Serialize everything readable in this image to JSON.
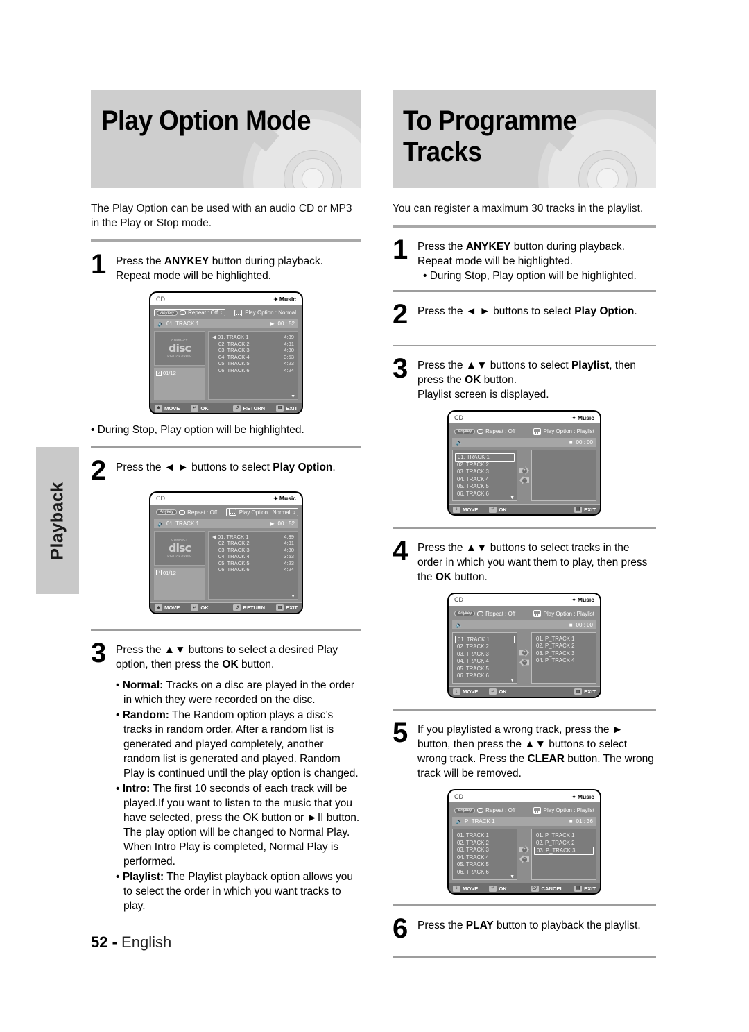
{
  "side_tab": {
    "label": "Playback"
  },
  "left": {
    "banner_title": "Play Option Mode",
    "intro": "The Play Option can be used with an audio CD or MP3 in the Play or Stop mode.",
    "steps": [
      {
        "num": "1",
        "line1_a": "Press the ",
        "line1_b": "ANYKEY",
        "line1_c": " button during playback.",
        "line2": "Repeat mode will be highlighted."
      },
      {
        "num": "2",
        "line1_a": "Press the ",
        "line1_b": "◄ ►",
        "line1_c": " buttons to select ",
        "line1_d": "Play Option",
        "line1_e": "."
      },
      {
        "num": "3",
        "line1_a": "Press the ",
        "line1_b": "▲▼",
        "line1_c": " buttons to select a desired Play option, then press the ",
        "line1_d": "OK",
        "line1_e": " button."
      }
    ],
    "note_stop": "• During Stop, Play option will be highlighted.",
    "bullets": [
      {
        "term": "Normal:",
        "text": " Tracks on a disc are played in the order in which they were recorded on the disc."
      },
      {
        "term": "Random:",
        "text": " The Random option plays a disc’s tracks in random order. After a random list is generated and played completely, another random list is generated and played. Random Play is continued until the play option is changed."
      },
      {
        "term": "Intro:",
        "text": " The first 10 seconds of each track will be played.If you want to listen to the music that you have selected, press the OK button or ►II button. The play option will be changed to Normal Play. When Intro Play is completed, Normal Play is performed."
      },
      {
        "term": "Playlist:",
        "text": " The Playlist playback option allows you to select the order in which you want tracks to play."
      }
    ]
  },
  "right": {
    "banner_title": "To Programme Tracks",
    "intro": "You can register a maximum 30 tracks in the playlist.",
    "steps": [
      {
        "num": "1",
        "line1_a": "Press the ",
        "line1_b": "ANYKEY",
        "line1_c": " button during playback.",
        "line2": "Repeat mode will be highlighted.",
        "note": "• During Stop, Play option will be highlighted."
      },
      {
        "num": "2",
        "line1_a": "Press the ",
        "line1_b": "◄ ►",
        "line1_c": " buttons to select ",
        "line1_d": "Play Option",
        "line1_e": "."
      },
      {
        "num": "3",
        "line1_a": "Press the ",
        "line1_b": "▲▼",
        "line1_c": " buttons to select ",
        "line1_d": "Playlist",
        "line1_e": ", then press the ",
        "line1_f": "OK",
        "line1_g": " button.",
        "line2": "Playlist screen is displayed."
      },
      {
        "num": "4",
        "line1_a": "Press the ",
        "line1_b": "▲▼",
        "line1_c": " buttons to select tracks in the order in which you want them to play, then press the ",
        "line1_d": "OK",
        "line1_e": " button."
      },
      {
        "num": "5",
        "line1_a": "If you playlisted a wrong track, press the ",
        "line1_b": "►",
        "line1_c": " button, then press the ",
        "line1_d": "▲▼",
        "line1_e": " buttons to select wrong track. Press the ",
        "line1_f": "CLEAR",
        "line1_g": " button. The wrong track will be removed."
      },
      {
        "num": "6",
        "line1_a": "Press the ",
        "line1_b": "PLAY",
        "line1_c": " button to playback the playlist."
      }
    ]
  },
  "osd_common": {
    "source": "CD",
    "music_label": "Music",
    "anykey": "Anykey",
    "repeat_label": "Repeat : Off",
    "cd_logo": {
      "top": "COMPACT",
      "mid": "disc",
      "bottom": "DIGITAL AUDIO"
    },
    "track_counter": "01/12",
    "foot_move": "MOVE",
    "foot_ok": "OK",
    "foot_return": "RETURN",
    "foot_exit": "EXIT",
    "foot_cancel": "CANCEL"
  },
  "osd1": {
    "play_option": "Play Option : Normal",
    "selected": "repeat",
    "now_playing": "01. TRACK 1",
    "time": "00 : 52",
    "state_icon": "▶",
    "tracks": [
      {
        "name": "01. TRACK 1",
        "time": "4:39",
        "playing": true
      },
      {
        "name": "02. TRACK 2",
        "time": "4:31",
        "playing": false
      },
      {
        "name": "03. TRACK 3",
        "time": "4:30",
        "playing": false
      },
      {
        "name": "04. TRACK 4",
        "time": "3:53",
        "playing": false
      },
      {
        "name": "05. TRACK 5",
        "time": "4:23",
        "playing": false
      },
      {
        "name": "06. TRACK 6",
        "time": "4:24",
        "playing": false
      }
    ]
  },
  "osd2": {
    "play_option": "Play Option : Normal",
    "selected": "play_option",
    "now_playing": "01. TRACK 1",
    "time": "00 : 52",
    "state_icon": "▶",
    "tracks": [
      {
        "name": "01. TRACK 1",
        "time": "4:39",
        "playing": true
      },
      {
        "name": "02. TRACK 2",
        "time": "4:31",
        "playing": false
      },
      {
        "name": "03. TRACK 3",
        "time": "4:30",
        "playing": false
      },
      {
        "name": "04. TRACK 4",
        "time": "3:53",
        "playing": false
      },
      {
        "name": "05. TRACK 5",
        "time": "4:23",
        "playing": false
      },
      {
        "name": "06. TRACK 6",
        "time": "4:24",
        "playing": false
      }
    ]
  },
  "osd3": {
    "play_option": "Play Option : Playlist",
    "now_playing": "",
    "time": "00 : 00",
    "state_icon": "■",
    "source_tracks": [
      {
        "name": "01. TRACK 1",
        "selected": true
      },
      {
        "name": "02. TRACK 2",
        "selected": false
      },
      {
        "name": "03. TRACK 3",
        "selected": false
      },
      {
        "name": "04. TRACK 4",
        "selected": false
      },
      {
        "name": "05. TRACK 5",
        "selected": false
      },
      {
        "name": "06. TRACK 6",
        "selected": false
      }
    ],
    "playlist_tracks": []
  },
  "osd4": {
    "play_option": "Play Option : Playlist",
    "now_playing": "",
    "time": "00 : 00",
    "state_icon": "■",
    "source_tracks": [
      {
        "name": "01. TRACK 1",
        "selected": true
      },
      {
        "name": "02. TRACK 2",
        "selected": false
      },
      {
        "name": "03. TRACK 3",
        "selected": false
      },
      {
        "name": "04. TRACK 4",
        "selected": false
      },
      {
        "name": "05. TRACK 5",
        "selected": false
      },
      {
        "name": "06. TRACK 6",
        "selected": false
      }
    ],
    "playlist_tracks": [
      {
        "name": "01. P_TRACK 1",
        "selected": false
      },
      {
        "name": "02. P_TRACK 2",
        "selected": false
      },
      {
        "name": "03. P_TRACK 3",
        "selected": false
      },
      {
        "name": "04. P_TRACK 4",
        "selected": false
      }
    ]
  },
  "osd5": {
    "play_option": "Play Option : Playlist",
    "now_playing": "P_TRACK 1",
    "time": "01 : 36",
    "state_icon": "■",
    "source_tracks": [
      {
        "name": "01. TRACK 1",
        "selected": false
      },
      {
        "name": "02. TRACK 2",
        "selected": false
      },
      {
        "name": "03. TRACK 3",
        "selected": false
      },
      {
        "name": "04. TRACK 4",
        "selected": false
      },
      {
        "name": "05. TRACK 5",
        "selected": false
      },
      {
        "name": "06. TRACK 6",
        "selected": false
      }
    ],
    "playlist_tracks": [
      {
        "name": "01. P_TRACK 1",
        "selected": false
      },
      {
        "name": "02. P_TRACK 2",
        "selected": false
      },
      {
        "name": "03. P_TRACK 3",
        "selected": true
      }
    ]
  },
  "footer": {
    "page": "52 -",
    "language": "English"
  },
  "colors": {
    "banner_bg": "#cecece",
    "rule": "#a8a8a8",
    "osd_bg": "#8d8d8d",
    "tab_bg": "#c9c9c9"
  }
}
